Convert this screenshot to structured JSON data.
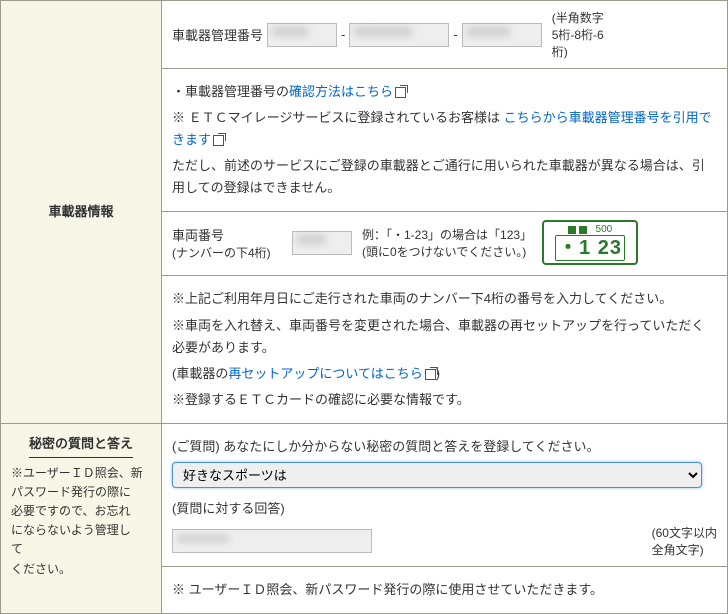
{
  "obu": {
    "section_title": "車載器情報",
    "mgmt_label": "車載器管理番号",
    "mgmt_sep": "-",
    "mgmt_format": "(半角数字\n5桁-8桁-6\n桁)",
    "confirm_prefix": "・車載器管理番号の",
    "confirm_link": "確認方法はこちら",
    "mileage_prefix": "※ ＥＴＣマイレージサービスに登録されているお客様は ",
    "mileage_link": "こちらから車載器管理番号を引用できます",
    "mileage_note": "ただし、前述のサービスにご登録の車載器とご通行に用いられた車載器が異なる場合は、引用しての登録はできません。",
    "veh_label": "車両番号",
    "veh_sub": "(ナンバーの下4桁)",
    "veh_ex1": "例：「・1-23」の場合は「123」",
    "veh_ex2": "(頭に0をつけないでください。)",
    "plate_top": "500",
    "plate_bottom": "・1 23",
    "note1": "※上記ご利用年月日にご走行された車両のナンバー下4桁の番号を入力してください。",
    "note2": "※車両を入れ替え、車両番号を変更された場合、車載器の再セットアップを行っていただく必要があります。",
    "note3_prefix": "(車載器の",
    "note3_link": "再セットアップについてはこちら",
    "note3_suffix": ")",
    "note4": "※登録するＥＴＣカードの確認に必要な情報です。"
  },
  "secret": {
    "section_title": "秘密の質問と答え",
    "section_note": "※ユーザーＩＤ照会、新\nパスワード発行の際に\n必要ですので、お忘れ\nにならないよう管理し\nて\nください。",
    "q_label": "(ご質問) あなたにしか分からない秘密の質問と答えを登録してください。",
    "q_option": "好きなスポーツは",
    "a_label": "(質問に対する回答)",
    "a_format": "(60文字以内\n全角文字)",
    "footer": "※ ユーザーＩＤ照会、新パスワード発行の際に使用させていただきます。"
  }
}
